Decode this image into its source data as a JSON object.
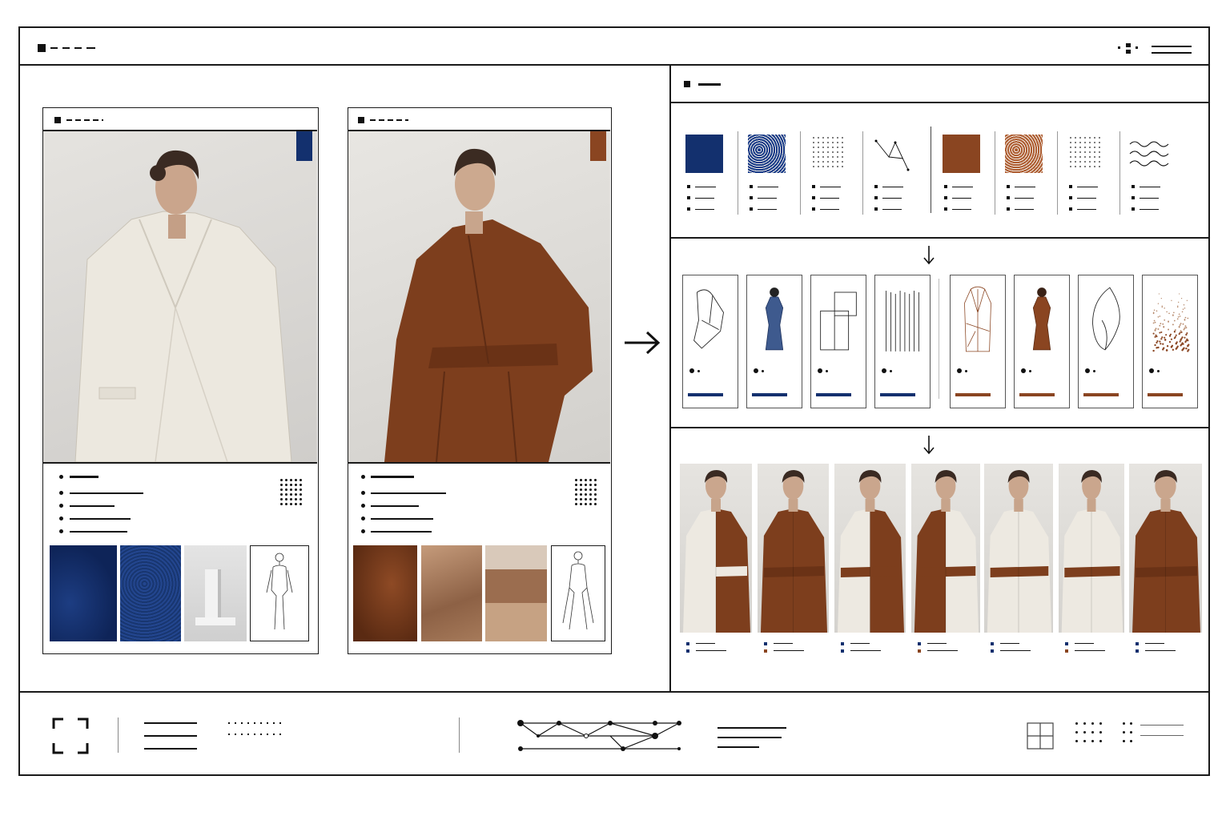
{
  "palette": {
    "ink": "#111111",
    "navy": "#13306e",
    "navy_texture": "#1f3f86",
    "rust": "#8a4521",
    "rust_light": "#a95e36",
    "cream": "#efebe3",
    "stone": "#d8d6d3",
    "sand": "#b98a6a"
  },
  "header": {
    "logo_icon": "square-icon",
    "menu_icon": "dots-icon"
  },
  "moodboards": [
    {
      "name": "white-coat-board",
      "accent": "#13306e",
      "garment": "#ede9e1",
      "swatches": [
        "navy-fabric",
        "navy-texture",
        "white-plinth",
        "figure-sketch"
      ]
    },
    {
      "name": "rust-coat-board",
      "accent": "#8a4521",
      "garment": "#7d3e1d",
      "swatches": [
        "rust-fabric",
        "desert-rock",
        "canyon",
        "figure-sketch"
      ]
    }
  ],
  "materials": {
    "items": [
      {
        "kind": "solid",
        "color": "#13306e"
      },
      {
        "kind": "texture",
        "color": "#1f3f86"
      },
      {
        "kind": "dots",
        "color": "#111111"
      },
      {
        "kind": "lines",
        "color": "#111111"
      },
      {
        "kind": "solid",
        "color": "#8a4521"
      },
      {
        "kind": "texture",
        "color": "#a95e36"
      },
      {
        "kind": "dots",
        "color": "#111111"
      },
      {
        "kind": "waves",
        "color": "#111111"
      }
    ]
  },
  "elements": {
    "cards": [
      {
        "kind": "drape-outline",
        "accent": "#13306e"
      },
      {
        "kind": "navy-form",
        "accent": "#13306e"
      },
      {
        "kind": "panels",
        "accent": "#13306e"
      },
      {
        "kind": "pleats",
        "accent": "#13306e"
      },
      {
        "kind": "coat-sketch",
        "accent": "#8a4521"
      },
      {
        "kind": "rust-form",
        "accent": "#8a4521"
      },
      {
        "kind": "leaf-curve",
        "accent": "#8a4521"
      },
      {
        "kind": "scatter",
        "accent": "#8a4521"
      }
    ]
  },
  "outputs": {
    "looks": [
      {
        "left": "#ede9e1",
        "right": "#7d3e1d",
        "belt": "#ede9e1"
      },
      {
        "left": "#7d3e1d",
        "right": "#7d3e1d",
        "belt": "#6a3216"
      },
      {
        "left": "#ede9e1",
        "right": "#7d3e1d",
        "belt": "#7d3e1d"
      },
      {
        "left": "#7d3e1d",
        "right": "#ede9e1",
        "belt": "#7d3e1d"
      },
      {
        "left": "#ede9e1",
        "right": "#ede9e1",
        "belt": "#7d3e1d"
      },
      {
        "left": "#ede9e1",
        "right": "#ede9e1",
        "belt": "#7d3e1d"
      },
      {
        "left": "#7d3e1d",
        "right": "#7d3e1d",
        "belt": "#6a3216"
      }
    ],
    "marker_colors": [
      "#13306e",
      "#8a4521"
    ]
  },
  "footer": {
    "icons": [
      "focus-frame-icon",
      "node-graph-icon",
      "grid-icon"
    ]
  }
}
